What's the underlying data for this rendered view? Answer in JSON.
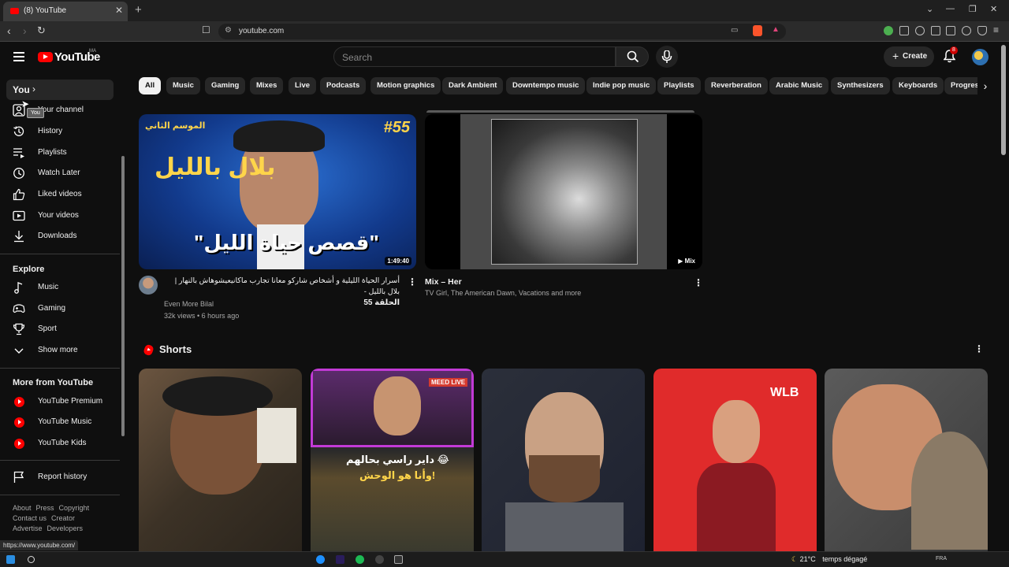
{
  "browser": {
    "tab_title": "(8) YouTube",
    "new_tab": "+",
    "url": "youtube.com",
    "status_url": "https://www.youtube.com/"
  },
  "header": {
    "logo_text": "YouTube",
    "logo_country": "MA",
    "search_placeholder": "Search",
    "create_label": "Create",
    "notifications_count": "8"
  },
  "sidebar": {
    "you_label": "You",
    "tooltip": "You",
    "you_items": [
      {
        "label": "Your channel",
        "icon": "user-icon"
      },
      {
        "label": "History",
        "icon": "history-icon"
      },
      {
        "label": "Playlists",
        "icon": "playlist-icon"
      },
      {
        "label": "Watch Later",
        "icon": "clock-icon"
      },
      {
        "label": "Liked videos",
        "icon": "thumb-up-icon"
      },
      {
        "label": "Your videos",
        "icon": "video-icon"
      },
      {
        "label": "Downloads",
        "icon": "download-icon"
      }
    ],
    "explore_title": "Explore",
    "explore_items": [
      {
        "label": "Music",
        "icon": "music-note-icon"
      },
      {
        "label": "Gaming",
        "icon": "gamepad-icon"
      },
      {
        "label": "Sport",
        "icon": "trophy-icon"
      },
      {
        "label": "Show more",
        "icon": "chevron-down-icon"
      }
    ],
    "more_title": "More from YouTube",
    "more_items": [
      {
        "label": "YouTube Premium",
        "icon": "youtube-premium-icon"
      },
      {
        "label": "YouTube Music",
        "icon": "youtube-music-icon"
      },
      {
        "label": "YouTube Kids",
        "icon": "youtube-kids-icon"
      }
    ],
    "report_history": "Report history",
    "footer_row1": [
      "About",
      "Press",
      "Copyright"
    ],
    "footer_row2": [
      "Contact us",
      "Creator"
    ],
    "footer_row3": [
      "Advertise",
      "Developers"
    ]
  },
  "chips": [
    "All",
    "Music",
    "Gaming",
    "Mixes",
    "Live",
    "Podcasts",
    "Motion graphics",
    "Dark Ambient",
    "Downtempo music",
    "Indie pop music",
    "Playlists",
    "Reverberation",
    "Arabic Music",
    "Synthesizers",
    "Keyboards",
    "Progres"
  ],
  "videos": [
    {
      "title_line1": "أسرار الحياة الليلية و أشخاص شاركو معانا تجارب ماكانيعيشوهاش بالنهار | بلال بالليل -",
      "title_line2": "الحلقة 55",
      "channel": "Even More Bilal",
      "meta": "32k views • 6 hours ago",
      "duration": "1:49:40",
      "thumb_badge": "#55",
      "thumb_season": "الموسم الثاني",
      "thumb_brand": "بلال بالليل",
      "thumb_caption": "\"قصص حياة الليل\""
    },
    {
      "title": "Mix – Her",
      "subtitle": "TV Girl, The American Dawn, Vacations and more",
      "badge": "Mix"
    }
  ],
  "shorts": {
    "title": "Shorts",
    "items": [
      {
        "caption": ""
      },
      {
        "caption_line1": "داير راسي بحالهم 😂",
        "caption_line2": "وأنا هو الوحش!",
        "live_badge": "MEED LIVE"
      },
      {
        "caption": ""
      },
      {
        "caption": "",
        "brand": "WLB"
      },
      {
        "caption": ""
      }
    ]
  },
  "taskbar": {
    "weather": "21°C",
    "weather_text": "temps dégagé",
    "lang": "FRA"
  }
}
